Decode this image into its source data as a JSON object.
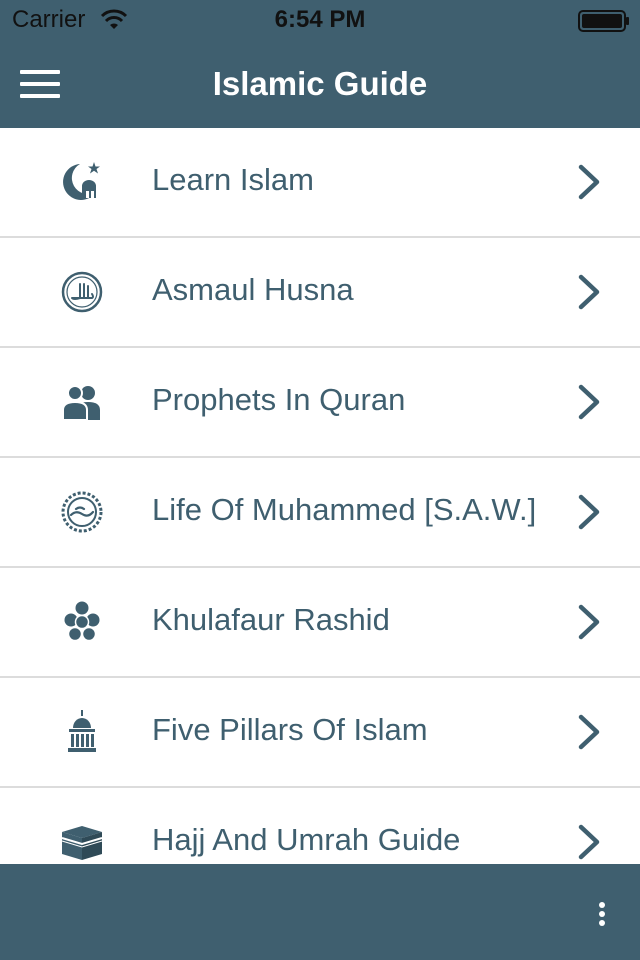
{
  "status_bar": {
    "carrier": "Carrier",
    "time": "6:54 PM",
    "wifi_icon": "wifi-icon",
    "battery_icon": "battery-icon"
  },
  "nav": {
    "title": "Islamic Guide",
    "menu_icon": "hamburger-menu-icon"
  },
  "menu_items": [
    {
      "label": "Learn Islam",
      "icon": "crescent-mosque-icon"
    },
    {
      "label": "Asmaul Husna",
      "icon": "allah-calligraphy-icon"
    },
    {
      "label": "Prophets In Quran",
      "icon": "people-icon"
    },
    {
      "label": "Life Of Muhammed [S.A.W.]",
      "icon": "muhammad-seal-icon"
    },
    {
      "label": "Khulafaur Rashid",
      "icon": "group-circles-icon"
    },
    {
      "label": "Five Pillars Of Islam",
      "icon": "pillars-dome-icon"
    },
    {
      "label": "Hajj And Umrah Guide",
      "icon": "kaaba-icon"
    }
  ],
  "bottom_bar": {
    "more_icon": "more-vertical-icon"
  },
  "colors": {
    "primary": "#3f5f6f",
    "background": "#ffffff",
    "divider": "#dcdcdc",
    "text_on_primary": "#ffffff"
  }
}
